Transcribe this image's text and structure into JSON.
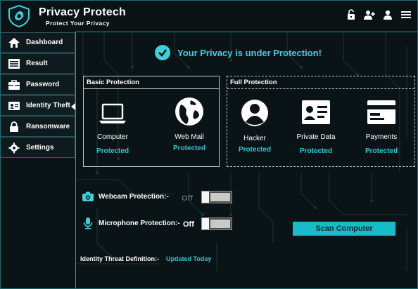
{
  "app": {
    "title": "Privacy Protech",
    "tagline": "Protect Your Privacy",
    "header_icons": [
      "unlock-icon",
      "add-user-icon",
      "user-icon",
      "menu-icon"
    ]
  },
  "sidebar": {
    "items": [
      {
        "label": "Dashboard",
        "icon": "home-icon"
      },
      {
        "label": "Result",
        "icon": "list-icon"
      },
      {
        "label": "Password",
        "icon": "briefcase-icon"
      },
      {
        "label": "Identity Theft",
        "icon": "id-card-icon",
        "active": true
      },
      {
        "label": "Ransomware",
        "icon": "lock-icon"
      },
      {
        "label": "Settings",
        "icon": "gear-icon"
      }
    ]
  },
  "main": {
    "status": "Your Privacy is under Protection!",
    "basic": {
      "title": "Basic Protection",
      "tiles": [
        {
          "name": "Computer",
          "status": "Protected",
          "icon": "laptop-icon"
        },
        {
          "name": "Web Mail",
          "status": "Protected",
          "icon": "globe-icon"
        }
      ]
    },
    "full": {
      "title": "Full Protection",
      "tiles": [
        {
          "name": "Hacker",
          "status": "Protected",
          "icon": "hacker-icon"
        },
        {
          "name": "Private Data",
          "status": "Protected",
          "icon": "id-card-icon"
        },
        {
          "name": "Payments",
          "status": "Protected",
          "icon": "credit-card-icon"
        }
      ]
    },
    "webcam": {
      "label": "Webcam Protection:-",
      "state": "Off",
      "icon": "camera-icon"
    },
    "microphone": {
      "label": "Microphone Protection:-",
      "state": "Off",
      "icon": "microphone-icon"
    },
    "scan_button": "Scan Computer",
    "definition": {
      "label": "Identity Threat Definition:-",
      "value": "Updated Today"
    }
  },
  "colors": {
    "accent": "#17bcc8",
    "protected": "#25c9d6",
    "status": "#3fd0dc"
  }
}
